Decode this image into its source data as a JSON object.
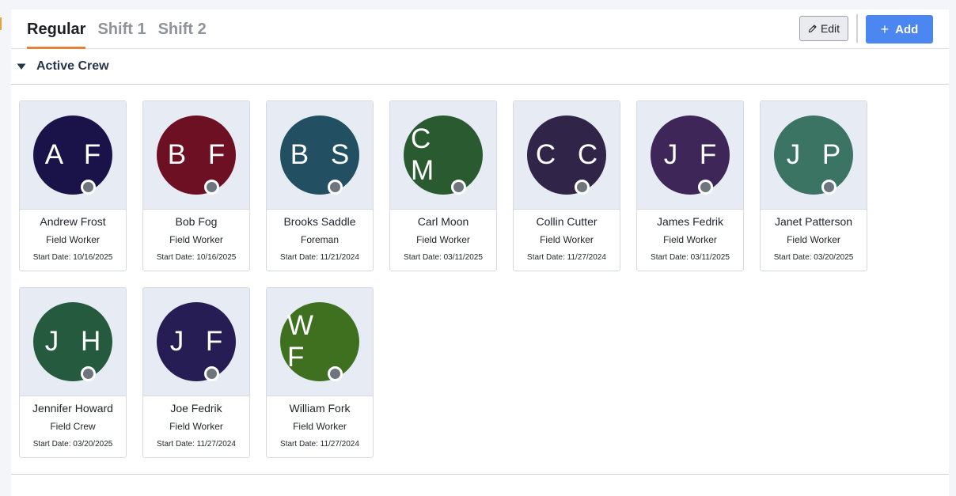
{
  "tabs": [
    {
      "label": "Regular",
      "active": true
    },
    {
      "label": "Shift 1",
      "active": false
    },
    {
      "label": "Shift 2",
      "active": false
    }
  ],
  "toolbar": {
    "edit_label": "Edit",
    "add_label": "Add",
    "add_icon": "+"
  },
  "section": {
    "title": "Active Crew",
    "icon": "caret-down-icon"
  },
  "colors": {
    "tab_underline": "#e57f3b",
    "add_button": "#4c86f0",
    "status_dot": "#6f757c"
  },
  "crew": [
    {
      "initials": "A F",
      "name": "Andrew Frost",
      "role": "Field Worker",
      "start_date": "Start Date: 10/16/2025",
      "color": "#19134a"
    },
    {
      "initials": "B F",
      "name": "Bob Fog",
      "role": "Field Worker",
      "start_date": "Start Date: 10/16/2025",
      "color": "#6e1024"
    },
    {
      "initials": "B S",
      "name": "Brooks Saddle",
      "role": "Foreman",
      "start_date": "Start Date: 11/21/2024",
      "color": "#224f61"
    },
    {
      "initials": "C M",
      "name": "Carl Moon",
      "role": "Field Worker",
      "start_date": "Start Date: 03/11/2025",
      "color": "#2a5a30"
    },
    {
      "initials": "C C",
      "name": "Collin Cutter",
      "role": "Field Worker",
      "start_date": "Start Date: 11/27/2024",
      "color": "#302549"
    },
    {
      "initials": "J F",
      "name": "James Fedrik",
      "role": "Field Worker",
      "start_date": "Start Date: 03/11/2025",
      "color": "#3f2659"
    },
    {
      "initials": "J P",
      "name": "Janet Patterson",
      "role": "Field Worker",
      "start_date": "Start Date: 03/20/2025",
      "color": "#3b7463"
    },
    {
      "initials": "J H",
      "name": "Jennifer Howard",
      "role": "Field Crew",
      "start_date": "Start Date: 03/20/2025",
      "color": "#255a3e"
    },
    {
      "initials": "J F",
      "name": "Joe Fedrik",
      "role": "Field Worker",
      "start_date": "Start Date: 11/27/2024",
      "color": "#261d55"
    },
    {
      "initials": "W F",
      "name": "William Fork",
      "role": "Field Worker",
      "start_date": "Start Date: 11/27/2024",
      "color": "#3f7020"
    }
  ]
}
